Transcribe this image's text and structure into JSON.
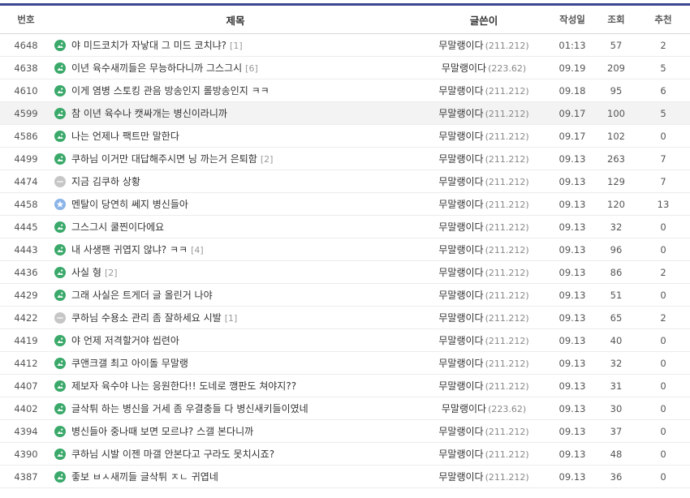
{
  "header": {
    "num": "번호",
    "title": "제목",
    "writer": "글쓴이",
    "date": "작성일",
    "views": "조회",
    "recommend": "추천"
  },
  "rows": [
    {
      "num": "4648",
      "icon": "image",
      "title": "야 미드코치가 자낳대 그 미드 코치냐?",
      "reply": "[1]",
      "nick": "무말랭이다",
      "ip": "(211.212)",
      "date": "01:13",
      "views": "57",
      "rec": "2"
    },
    {
      "num": "4638",
      "icon": "image",
      "title": "이년 육수새끼들은 무능하다니까 그스그시",
      "reply": "[6]",
      "nick": "무말랭이다",
      "ip": "(223.62)",
      "date": "09.19",
      "views": "209",
      "rec": "5"
    },
    {
      "num": "4610",
      "icon": "image",
      "title": "이게 염병 스토킹 관음 방송인지 롤방송인지 ㅋㅋ",
      "reply": "",
      "nick": "무말랭이다",
      "ip": "(211.212)",
      "date": "09.18",
      "views": "95",
      "rec": "6"
    },
    {
      "num": "4599",
      "icon": "image",
      "title": "참 이년 육수나 캣싸개는 병신이라니까",
      "reply": "",
      "nick": "무말랭이다",
      "ip": "(211.212)",
      "date": "09.17",
      "views": "100",
      "rec": "5"
    },
    {
      "num": "4586",
      "icon": "image",
      "title": "나는 언제나 팩트만 말한다",
      "reply": "",
      "nick": "무말랭이다",
      "ip": "(211.212)",
      "date": "09.17",
      "views": "102",
      "rec": "0"
    },
    {
      "num": "4499",
      "icon": "image",
      "title": "쿠하님 이거만 대답해주시면 닝 까는거 은퇴함",
      "reply": "[2]",
      "nick": "무말랭이다",
      "ip": "(211.212)",
      "date": "09.13",
      "views": "263",
      "rec": "7"
    },
    {
      "num": "4474",
      "icon": "chat",
      "title": "지금 김쿠하 상황",
      "reply": "",
      "nick": "무말랭이다",
      "ip": "(211.212)",
      "date": "09.13",
      "views": "129",
      "rec": "7"
    },
    {
      "num": "4458",
      "icon": "star",
      "title": "멘탈이 당연히 쎄지 병신들아",
      "reply": "",
      "nick": "무말랭이다",
      "ip": "(211.212)",
      "date": "09.13",
      "views": "120",
      "rec": "13"
    },
    {
      "num": "4445",
      "icon": "image",
      "title": "그스그시 쿨찐이다에요",
      "reply": "",
      "nick": "무말랭이다",
      "ip": "(211.212)",
      "date": "09.13",
      "views": "32",
      "rec": "0"
    },
    {
      "num": "4443",
      "icon": "image",
      "title": "내 사생팬 귀엽지 않냐? ㅋㅋ",
      "reply": "[4]",
      "nick": "무말랭이다",
      "ip": "(211.212)",
      "date": "09.13",
      "views": "96",
      "rec": "0"
    },
    {
      "num": "4436",
      "icon": "image",
      "title": "사실 형",
      "reply": "[2]",
      "nick": "무말랭이다",
      "ip": "(211.212)",
      "date": "09.13",
      "views": "86",
      "rec": "2"
    },
    {
      "num": "4429",
      "icon": "image",
      "title": "그래 사실은 트게더 글 올린거 나야",
      "reply": "",
      "nick": "무말랭이다",
      "ip": "(211.212)",
      "date": "09.13",
      "views": "51",
      "rec": "0"
    },
    {
      "num": "4422",
      "icon": "chat",
      "title": "쿠하님 수용소 관리 좀 잘하세요 시발",
      "reply": "[1]",
      "nick": "무말랭이다",
      "ip": "(211.212)",
      "date": "09.13",
      "views": "65",
      "rec": "2"
    },
    {
      "num": "4419",
      "icon": "image",
      "title": "야 언제 저격할거야 씹련아",
      "reply": "",
      "nick": "무말랭이다",
      "ip": "(211.212)",
      "date": "09.13",
      "views": "40",
      "rec": "0"
    },
    {
      "num": "4412",
      "icon": "image",
      "title": "쿠앤크갤 최고 아이돌 무말랭",
      "reply": "",
      "nick": "무말랭이다",
      "ip": "(211.212)",
      "date": "09.13",
      "views": "32",
      "rec": "0"
    },
    {
      "num": "4407",
      "icon": "image",
      "title": "제보자 육수야 나는 응원한다!! 도네로 깽판도 쳐야지??",
      "reply": "",
      "nick": "무말랭이다",
      "ip": "(211.212)",
      "date": "09.13",
      "views": "31",
      "rec": "0"
    },
    {
      "num": "4402",
      "icon": "image",
      "title": "글삭튀 하는 병신을 거세 좀 우결충들 다 병신새키들이였네",
      "reply": "",
      "nick": "무말랭이다",
      "ip": "(223.62)",
      "date": "09.13",
      "views": "30",
      "rec": "0"
    },
    {
      "num": "4394",
      "icon": "image",
      "title": "병신들아 중나때 보면 모르냐? 스갤 본다니까",
      "reply": "",
      "nick": "무말랭이다",
      "ip": "(211.212)",
      "date": "09.13",
      "views": "37",
      "rec": "0"
    },
    {
      "num": "4390",
      "icon": "image",
      "title": "쿠하님 시발 이젠 마갤 안본다고 구라도 못치시죠?",
      "reply": "",
      "nick": "무말랭이다",
      "ip": "(211.212)",
      "date": "09.13",
      "views": "48",
      "rec": "0"
    },
    {
      "num": "4387",
      "icon": "image",
      "title": "좋보 ㅂㅅ새끼들 글삭튀 ㅈㄴ 귀엽네",
      "reply": "",
      "nick": "무말랭이다",
      "ip": "(211.212)",
      "date": "09.13",
      "views": "36",
      "rec": "0"
    }
  ],
  "highlight_row": 3,
  "colors": {
    "accent": "#3b4890",
    "image_icon": "#3aa96a",
    "chat_icon": "#c6c6c6",
    "star_icon": "#8ab4e8"
  }
}
